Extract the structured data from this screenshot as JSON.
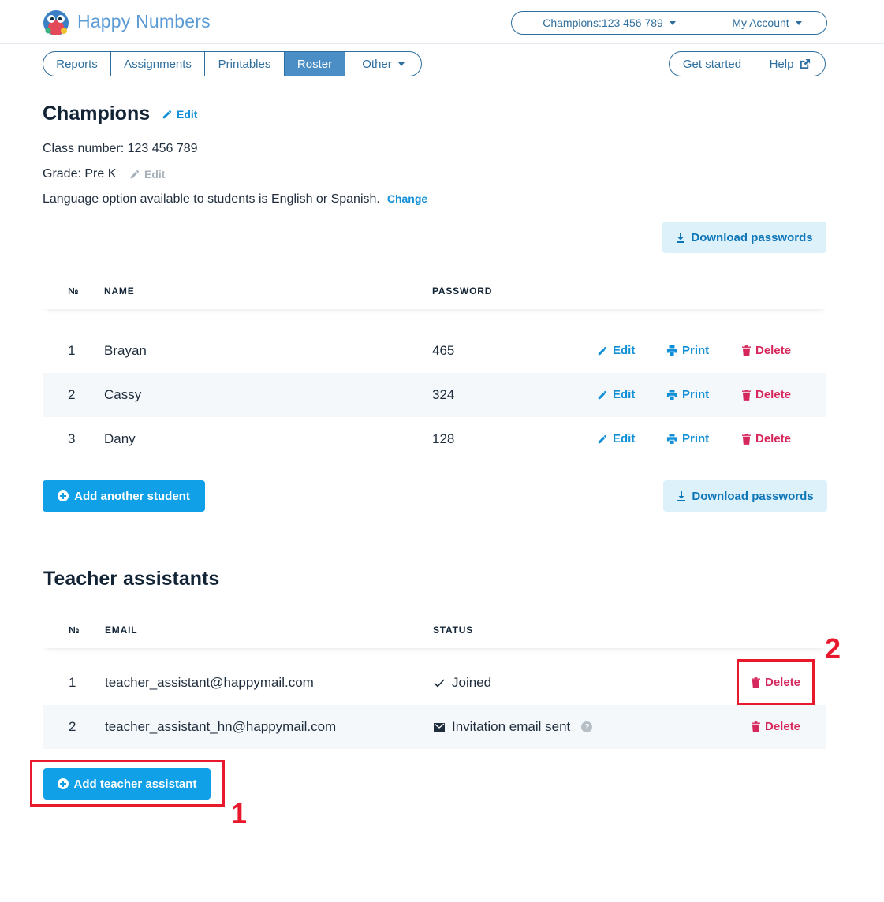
{
  "header": {
    "brand": "Happy Numbers",
    "class_selector": "Champions:123 456 789",
    "account_menu": "My Account"
  },
  "nav": {
    "tabs": [
      "Reports",
      "Assignments",
      "Printables",
      "Roster",
      "Other"
    ],
    "active_tab": "Roster",
    "right": [
      "Get started",
      "Help"
    ]
  },
  "class_info": {
    "title": "Champions",
    "edit_label": "Edit",
    "class_number": "Class number: 123 456 789",
    "grade": "Grade: Pre K",
    "grade_edit_label": "Edit",
    "language_text": "Language option available to students is English or Spanish.",
    "change_label": "Change",
    "download_label": "Download passwords"
  },
  "students": {
    "headers": [
      "№",
      "NAME",
      "PASSWORD"
    ],
    "rows": [
      {
        "num": "1",
        "name": "Brayan",
        "password": "465"
      },
      {
        "num": "2",
        "name": "Cassy",
        "password": "324"
      },
      {
        "num": "3",
        "name": "Dany",
        "password": "128"
      }
    ],
    "actions": {
      "edit": "Edit",
      "print": "Print",
      "delete": "Delete"
    },
    "add_label": "Add another student",
    "download_label": "Download passwords"
  },
  "assistants": {
    "title": "Teacher assistants",
    "headers": [
      "№",
      "EMAIL",
      "STATUS"
    ],
    "rows": [
      {
        "num": "1",
        "email": "teacher_assistant@happymail.com",
        "status": "Joined",
        "delete": "Delete"
      },
      {
        "num": "2",
        "email": "teacher_assistant_hn@happymail.com",
        "status": "Invitation email sent",
        "delete": "Delete"
      }
    ],
    "add_label": "Add teacher assistant"
  },
  "annotations": {
    "callout_1": "1",
    "callout_2": "2"
  },
  "colors": {
    "brand": "#5b9bd5",
    "nav_border": "#2f6f9f",
    "nav_active": "#4a8ec5",
    "link_blue": "#1190d8",
    "primary_button": "#0fa0e8",
    "light_button": "#ddf1fb",
    "delete_red": "#d6275c",
    "callout_red": "#e8192c"
  },
  "icons": [
    "logo-mascot-icon",
    "caret-down-icon",
    "external-link-icon",
    "pencil-icon",
    "download-icon",
    "printer-icon",
    "trash-icon",
    "plus-circle-icon",
    "checkmark-icon",
    "envelope-icon",
    "question-icon"
  ]
}
